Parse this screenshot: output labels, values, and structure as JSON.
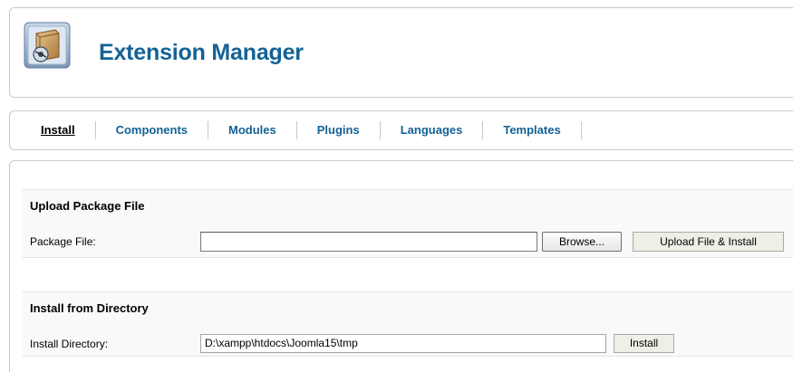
{
  "header": {
    "title": "Extension Manager",
    "icon": "extension-box-icon"
  },
  "tabs": [
    {
      "label": "Install",
      "active": true
    },
    {
      "label": "Components",
      "active": false
    },
    {
      "label": "Modules",
      "active": false
    },
    {
      "label": "Plugins",
      "active": false
    },
    {
      "label": "Languages",
      "active": false
    },
    {
      "label": "Templates",
      "active": false
    }
  ],
  "upload": {
    "heading": "Upload Package File",
    "field_label": "Package File:",
    "field_value": "",
    "browse_label": "Browse...",
    "submit_label": "Upload File & Install"
  },
  "directory": {
    "heading": "Install from Directory",
    "field_label": "Install Directory:",
    "field_value": "D:\\xampp\\htdocs\\Joomla15\\tmp",
    "submit_label": "Install"
  },
  "colors": {
    "title": "#146295",
    "tab_link": "#146295",
    "tab_active": "#000000",
    "section_bg": "#f9f9f9",
    "border": "#c9c9c9"
  }
}
